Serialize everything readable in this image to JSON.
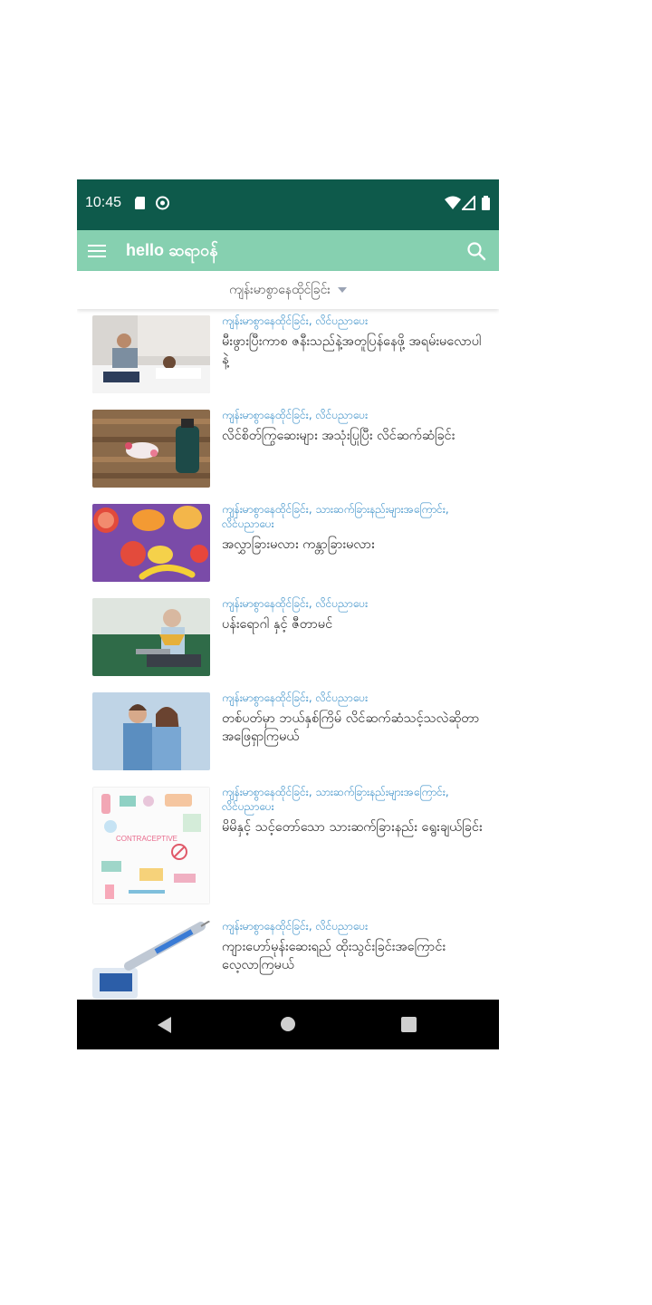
{
  "status_bar": {
    "time": "10:45"
  },
  "app_bar": {
    "title": "hello ဆရာဝန်",
    "menu_icon": "hamburger-icon",
    "search_icon": "search-icon"
  },
  "filter": {
    "selected": "ကျန်းမာစွာနေထိုင်ခြင်း"
  },
  "articles": [
    {
      "category": "ကျန်းမာစွာနေထိုင်ခြင်း, လိင်ပညာပေး",
      "title": "မီးဖွားပြီးကာစ ဇနီးသည်နဲ့အတူပြန်နေဖို့ အရမ်းမလောပါနဲ့",
      "thumb": "couple-in-bed"
    },
    {
      "category": "ကျန်းမာစွာနေထိုင်ခြင်း, လိင်ပညာပေး",
      "title": "လိင်စိတ်ကြွဆေးများ အသုံးပြုပြီး လိင်ဆက်ဆံခြင်း",
      "thumb": "pills-bottle"
    },
    {
      "category": "ကျန်းမာစွာနေထိုင်ခြင်း, သားဆက်ခြားနည်းများအကြောင်း, လိင်ပညာပေး",
      "title": "အလွှာခြားမလား ကန္တာခြားမလား",
      "thumb": "fruits"
    },
    {
      "category": "ကျန်းမာစွာနေထိုင်ခြင်း, လိင်ပညာပေး",
      "title": "ပန်းရောဂါ နှင့် ဇီတာမင်",
      "thumb": "elderly-man-laptop"
    },
    {
      "category": "ကျန်းမာစွာနေထိုင်ခြင်း, လိင်ပညာပေး",
      "title": "တစ်ပတ်မှာ ဘယ်နှစ်ကြိမ် လိင်ဆက်ဆံသင့်သလဲဆိုတာ အဖြေရှာကြမယ်",
      "thumb": "couple-back-to-back"
    },
    {
      "category": "ကျန်းမာစွာနေထိုင်ခြင်း, သားဆက်ခြားနည်းများအကြောင်း, လိင်ပညာပေး",
      "title": "မိမိနှင့် သင့်တော်သော သားဆက်ခြားနည်း ရွေးချယ်ခြင်း",
      "thumb": "contraceptive-illustration",
      "thumb_text": "CONTRACEPTIVE"
    },
    {
      "category": "ကျန်းမာစွာနေထိုင်ခြင်း, လိင်ပညာပေး",
      "title": "ကျားဟော်မုန်းဆေးရည် ထိုးသွင်းခြင်းအကြောင်း လေ့လာကြမယ်",
      "thumb": "testosterone-vial"
    }
  ],
  "colors": {
    "status_bar": "#0e5a4b",
    "app_bar": "#86d0b0",
    "category_text": "#3a8fc8",
    "nav_bar": "#000000"
  }
}
